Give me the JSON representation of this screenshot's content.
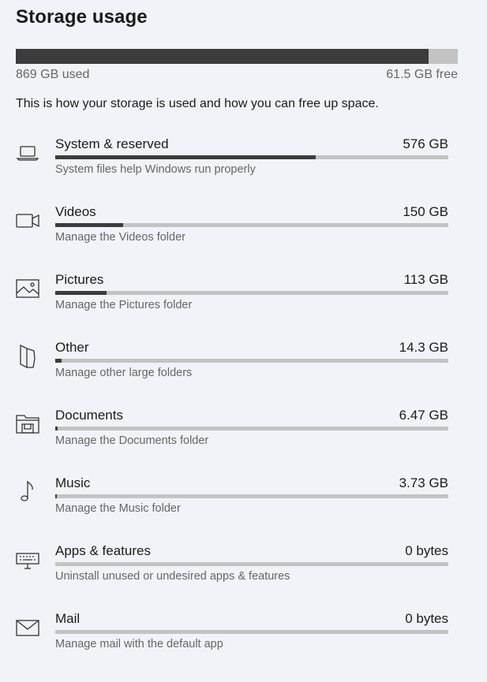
{
  "title": "Storage usage",
  "total": {
    "used_label": "869 GB used",
    "free_label": "61.5 GB free",
    "used_fraction": 0.934
  },
  "description": "This is how your storage is used and how you can free up space.",
  "categories": [
    {
      "name": "System & reserved",
      "size": "576 GB",
      "subtitle": "System files help Windows run properly",
      "fraction": 0.663,
      "icon": "laptop-icon"
    },
    {
      "name": "Videos",
      "size": "150 GB",
      "subtitle": "Manage the Videos folder",
      "fraction": 0.172,
      "icon": "video-camera-icon"
    },
    {
      "name": "Pictures",
      "size": "113 GB",
      "subtitle": "Manage the Pictures folder",
      "fraction": 0.13,
      "icon": "picture-icon"
    },
    {
      "name": "Other",
      "size": "14.3 GB",
      "subtitle": "Manage other large folders",
      "fraction": 0.016,
      "icon": "map-icon"
    },
    {
      "name": "Documents",
      "size": "6.47 GB",
      "subtitle": "Manage the Documents folder",
      "fraction": 0.007,
      "icon": "documents-folder-icon"
    },
    {
      "name": "Music",
      "size": "3.73 GB",
      "subtitle": "Manage the Music folder",
      "fraction": 0.004,
      "icon": "music-note-icon"
    },
    {
      "name": "Apps & features",
      "size": "0 bytes",
      "subtitle": "Uninstall unused or undesired apps & features",
      "fraction": 0,
      "icon": "keyboard-icon"
    },
    {
      "name": "Mail",
      "size": "0 bytes",
      "subtitle": "Manage mail with the default app",
      "fraction": 0,
      "icon": "mail-icon"
    }
  ]
}
